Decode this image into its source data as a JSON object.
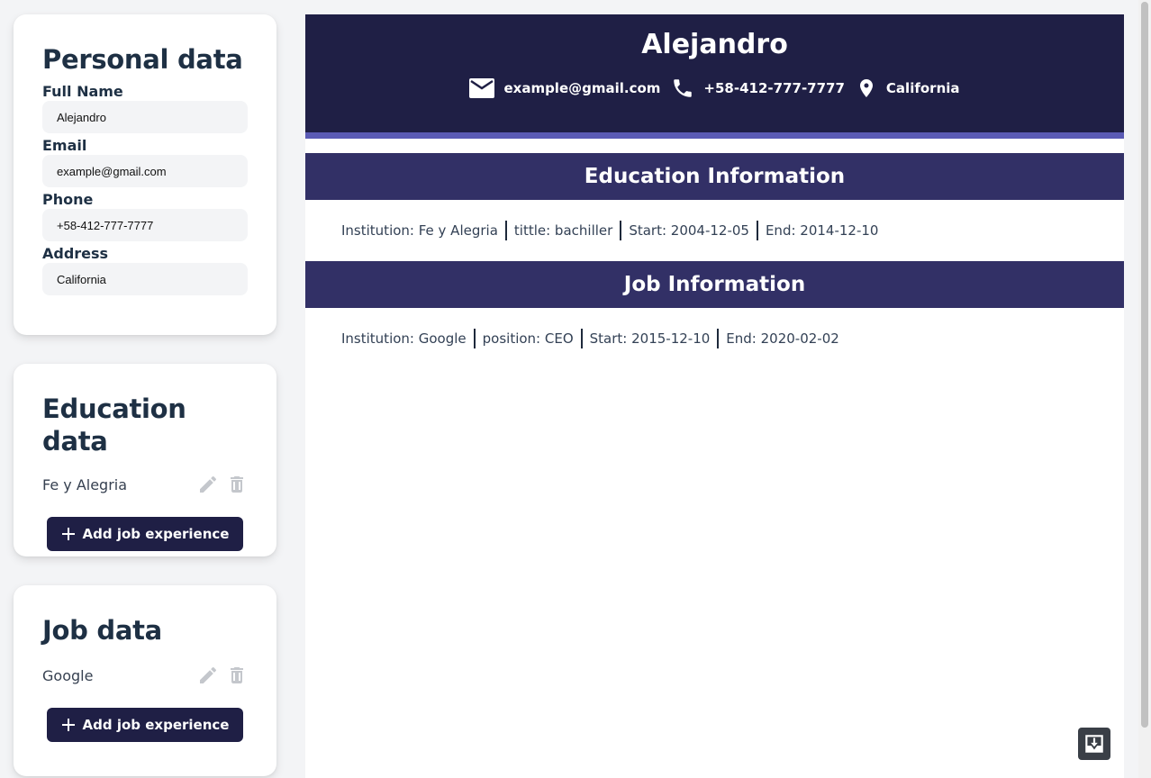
{
  "sidebar": {
    "personal": {
      "title": "Personal data",
      "fields": [
        {
          "label": "Full Name",
          "value": "Alejandro"
        },
        {
          "label": "Email",
          "value": "example@gmail.com"
        },
        {
          "label": "Phone",
          "value": "+58-412-777-7777"
        },
        {
          "label": "Address",
          "value": "California"
        }
      ]
    },
    "education": {
      "title": "Education data",
      "items": [
        "Fe y Alegria"
      ],
      "add_label": "Add job experience"
    },
    "job": {
      "title": "Job data",
      "items": [
        "Google"
      ],
      "add_label": "Add job experience"
    }
  },
  "preview": {
    "name": "Alejandro",
    "email": "example@gmail.com",
    "phone": "+58-412-777-7777",
    "location": "California",
    "education_title": "Education Information",
    "education_entry": {
      "institution": "Institution: Fe y Alegria",
      "title": "tittle: bachiller",
      "start": "Start: 2004-12-05",
      "end": "End: 2014-12-10"
    },
    "job_title": "Job Information",
    "job_entry": {
      "institution": "Institution: Google",
      "position": "position: CEO",
      "start": "Start: 2015-12-10",
      "end": "End: 2020-02-02"
    }
  },
  "icons": {
    "edit": "pencil-icon",
    "delete": "trash-icon",
    "add": "plus-icon",
    "email": "mail-icon",
    "phone": "phone-icon",
    "location": "location-pin-icon",
    "download": "download-icon"
  },
  "colors": {
    "header_bg": "#1f1f45",
    "section_bg": "#323066",
    "accent": "#5b5bb5",
    "button_bg": "#1f1f45"
  }
}
